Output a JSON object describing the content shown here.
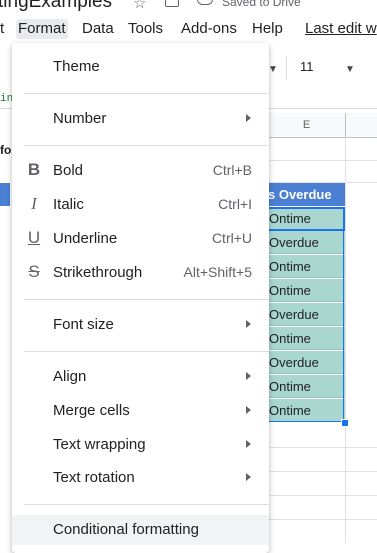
{
  "titlebar": {
    "doc_title": "tingExamples",
    "saved": "Saved to Drive"
  },
  "menubar": {
    "items": [
      "t",
      "Format",
      "Data",
      "Tools",
      "Add-ons",
      "Help"
    ],
    "last_edit": "Last edit w"
  },
  "toolbar": {
    "font_size": "11"
  },
  "formula_stub": "in",
  "sheet": {
    "column_header": "E",
    "left_stub": "fo",
    "header_cell": "s Overdue",
    "cells": [
      "Ontime",
      "Overdue",
      "Ontime",
      "Ontime",
      "Overdue",
      "Ontime",
      "Overdue",
      "Ontime",
      "Ontime"
    ],
    "colors": {
      "header_bg": "#4a7fd3",
      "cell_bg": "#a9d7d0",
      "selection": "#1a73e8"
    }
  },
  "menu": {
    "theme": "Theme",
    "number": "Number",
    "bold": "Bold",
    "bold_sc": "Ctrl+B",
    "italic": "Italic",
    "italic_sc": "Ctrl+I",
    "underline": "Underline",
    "underline_sc": "Ctrl+U",
    "strike": "Strikethrough",
    "strike_sc": "Alt+Shift+5",
    "font_size": "Font size",
    "align": "Align",
    "merge": "Merge cells",
    "wrap": "Text wrapping",
    "rotation": "Text rotation",
    "conditional": "Conditional formatting",
    "icons": {
      "bold": "B",
      "italic": "I",
      "underline": "U",
      "strike": "S"
    }
  }
}
